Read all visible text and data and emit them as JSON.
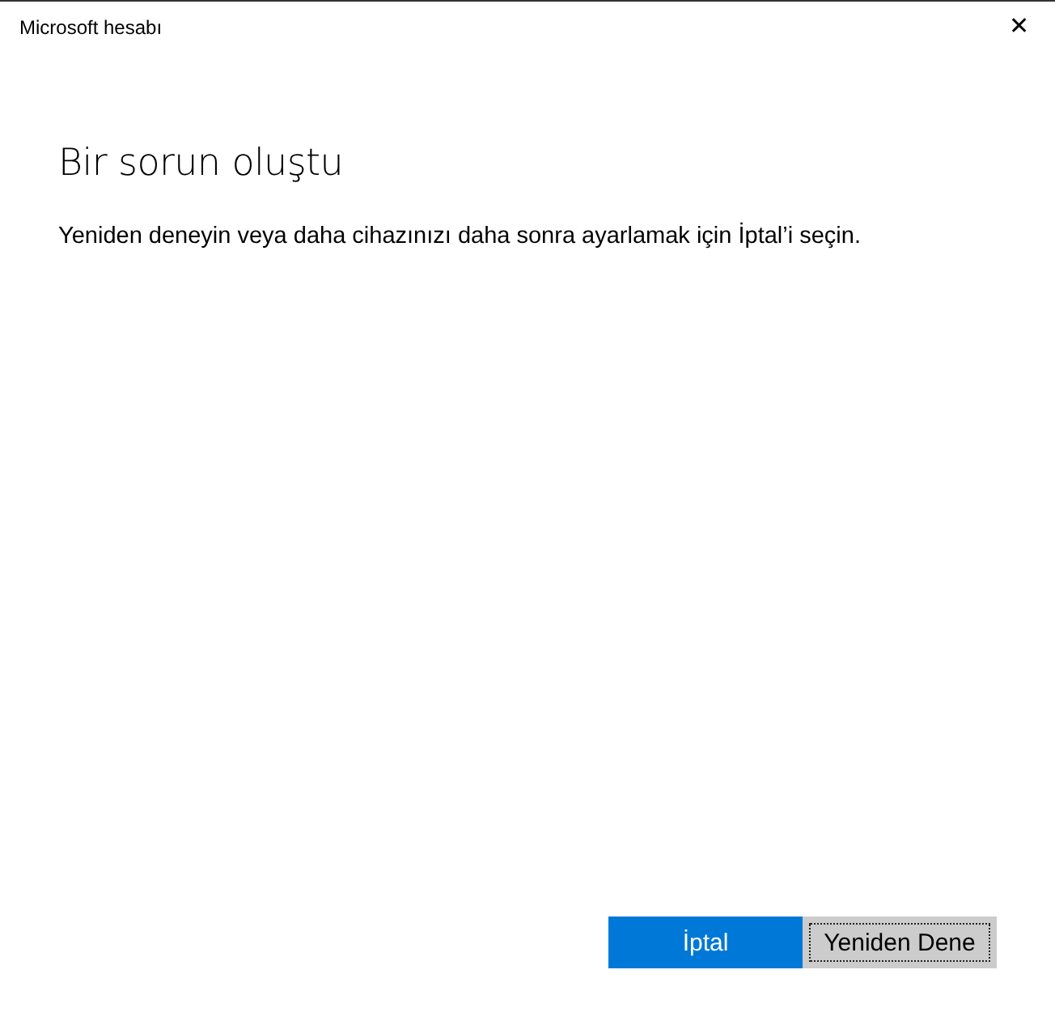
{
  "window": {
    "title": "Microsoft hesabı",
    "close": "✕"
  },
  "heading": "Bir sorun oluştu",
  "message": "Yeniden deneyin veya daha cihazınızı daha sonra ayarlamak için İptal’i seçin.",
  "buttons": [
    {
      "label": "İptal",
      "kind": "primary",
      "focused": false
    },
    {
      "label": "Yeniden Dene",
      "kind": "secondary",
      "focused": true
    }
  ]
}
